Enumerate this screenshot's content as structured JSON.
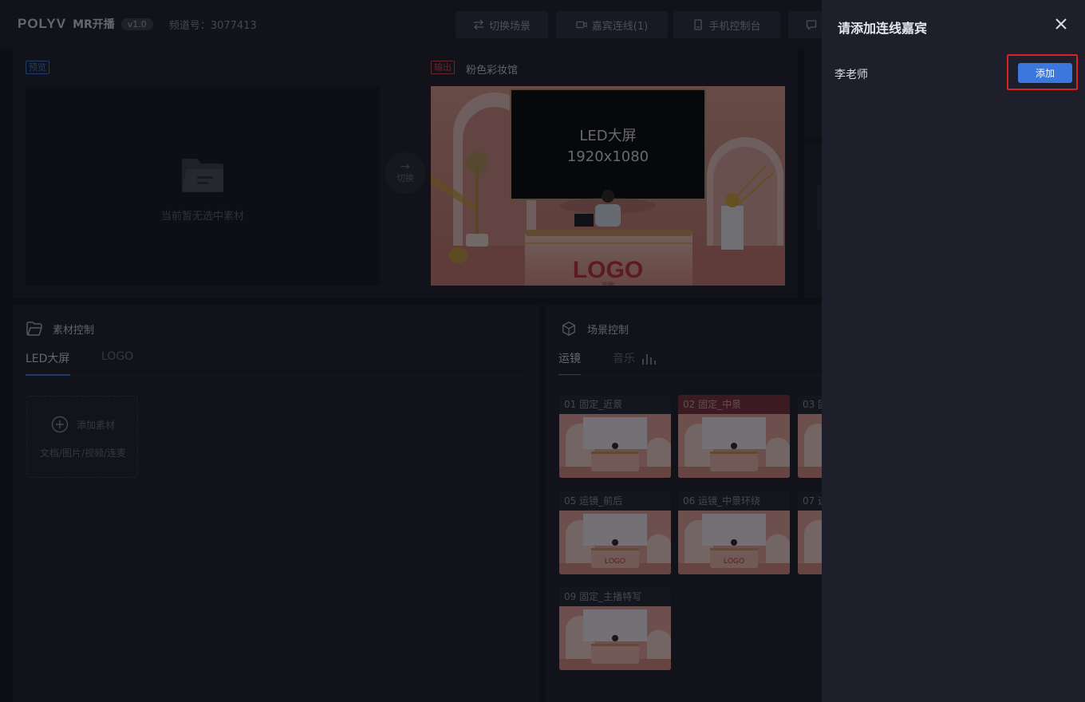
{
  "header": {
    "brand": "POLYV",
    "app_name": "MR开播",
    "version": "v1.0",
    "channel": "频道号：3077413",
    "buttons": {
      "switch_scene": "切换场景",
      "guest_connect": "嘉宾连线(1)",
      "mobile_console": "手机控制台"
    }
  },
  "preview": {
    "tag": "预览",
    "empty_text": "当前暂无选中素材",
    "switch_label": "切换"
  },
  "output": {
    "tag": "输出",
    "title": "粉色彩妆馆",
    "screen_line1": "LED大屏",
    "screen_line2": "1920x1080",
    "desk_logo": "LOGO",
    "desk_sub": "示例"
  },
  "material": {
    "title": "素材控制",
    "tabs": [
      "LED大屏",
      "LOGO"
    ],
    "active_tab": 0,
    "add_label": "添加素材",
    "add_sub": "文档/图片/视频/连麦"
  },
  "scene": {
    "title": "场景控制",
    "tabs": [
      "运镜",
      "音乐"
    ],
    "thumbs": [
      {
        "label": "01 固定_近景",
        "active": false,
        "desk_logo": ""
      },
      {
        "label": "02 固定_中景",
        "active": true,
        "desk_logo": ""
      },
      {
        "label": "03 固",
        "active": false,
        "desk_logo": ""
      },
      {
        "label": "05 运镜_前后",
        "active": false,
        "desk_logo": "LOGO"
      },
      {
        "label": "06 运镜_中景环绕",
        "active": false,
        "desk_logo": "LOGO"
      },
      {
        "label": "07 运",
        "active": false,
        "desk_logo": ""
      },
      {
        "label": "09 固定_主播特写",
        "active": false,
        "desk_logo": ""
      }
    ]
  },
  "drawer": {
    "title": "请添加连线嘉宾",
    "guest_name": "李老师",
    "add_button": "添加"
  },
  "colors": {
    "accent": "#3a78e0",
    "highlight": "#e02020",
    "output_tag": "#d94848"
  }
}
